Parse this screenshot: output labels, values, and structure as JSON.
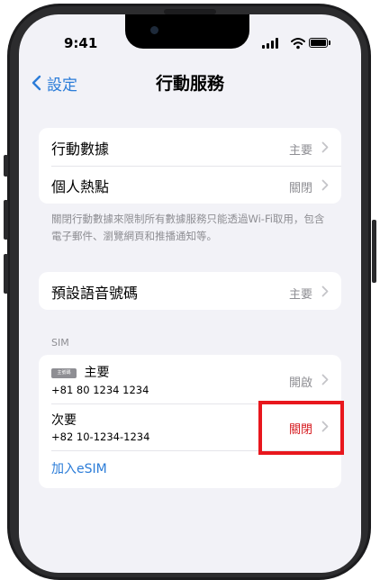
{
  "status_bar": {
    "time": "9:41"
  },
  "nav": {
    "back_label": "設定",
    "title": "行動服務"
  },
  "cellular_group": {
    "items": [
      {
        "label": "行動數據",
        "value": "主要"
      },
      {
        "label": "個人熱點",
        "value": "關閉"
      }
    ]
  },
  "footer_note": "關閉行動數據來限制所有數據服務只能透過Wi-Fi取用，包含電子郵件、瀏覽網頁和推播通知等。",
  "voice_group": {
    "items": [
      {
        "label": "預設語音號碼",
        "value": "主要"
      }
    ]
  },
  "sim_section": {
    "header": "SIM",
    "lines": [
      {
        "badge": "主號碼",
        "label": "主要",
        "number": "+81 80 1234 1234",
        "value": "開啟"
      },
      {
        "label": "次要",
        "number": "+82 10-1234-1234",
        "value": "關閉"
      }
    ],
    "add_label": "加入eSIM"
  },
  "colors": {
    "accent": "#2b7cd8",
    "highlight": "#e8171d",
    "background": "#f2f2f7"
  }
}
